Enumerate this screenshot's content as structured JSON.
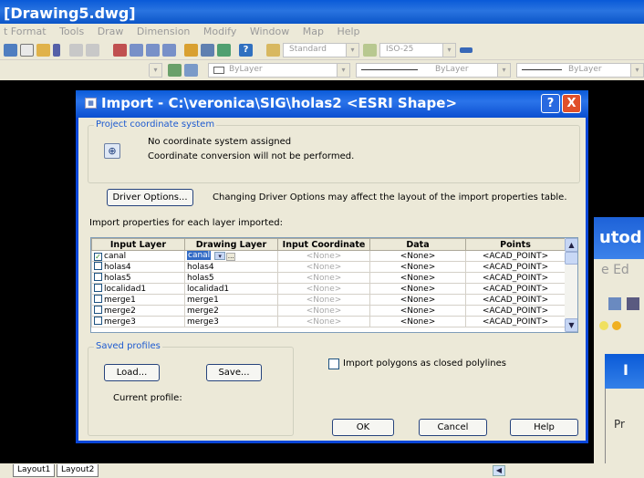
{
  "acad": {
    "title": "[Drawing5.dwg]",
    "menu": [
      "t Format",
      "Tools",
      "Draw",
      "Dimension",
      "Modify",
      "Window",
      "Map",
      "Help"
    ],
    "text_style": "Standard",
    "dim_style": "ISO-25",
    "layer_color": "ByLayer",
    "linetype": "ByLayer",
    "lineweight": "ByLayer",
    "tabs": [
      "Layout1",
      "Layout2"
    ]
  },
  "bg_window2": {
    "title_fragment": "utod",
    "menu_fragment": "e  Ed",
    "dialog_title_fragment": "I",
    "body_fragment": "Pr"
  },
  "dialog": {
    "title": "Import - C:\\veronica\\SIG\\holas2 <ESRI Shape>",
    "help_label": "?",
    "close_label": "X",
    "coord_group_label": "Project coordinate system",
    "coord_line1": "No coordinate system assigned",
    "coord_line2": "Coordinate conversion will not be performed.",
    "driver_button": "Driver Options...",
    "driver_note": "Changing Driver Options may affect the layout of the import properties table.",
    "import_props_label": "Import properties for each layer imported:",
    "columns": [
      "Input Layer",
      "Drawing Layer",
      "Input Coordinate",
      "Data",
      "Points"
    ],
    "rows": [
      {
        "checked": true,
        "input": "canal",
        "drawing": "canal",
        "coord": "<None>",
        "data": "<None>",
        "points": "<ACAD_POINT>"
      },
      {
        "checked": false,
        "input": "holas4",
        "drawing": "holas4",
        "coord": "<None>",
        "data": "<None>",
        "points": "<ACAD_POINT>"
      },
      {
        "checked": false,
        "input": "holas5",
        "drawing": "holas5",
        "coord": "<None>",
        "data": "<None>",
        "points": "<ACAD_POINT>"
      },
      {
        "checked": false,
        "input": "localidad1",
        "drawing": "localidad1",
        "coord": "<None>",
        "data": "<None>",
        "points": "<ACAD_POINT>"
      },
      {
        "checked": false,
        "input": "merge1",
        "drawing": "merge1",
        "coord": "<None>",
        "data": "<None>",
        "points": "<ACAD_POINT>"
      },
      {
        "checked": false,
        "input": "merge2",
        "drawing": "merge2",
        "coord": "<None>",
        "data": "<None>",
        "points": "<ACAD_POINT>"
      },
      {
        "checked": false,
        "input": "merge3",
        "drawing": "merge3",
        "coord": "<None>",
        "data": "<None>",
        "points": "<ACAD_POINT>"
      }
    ],
    "profiles_group_label": "Saved profiles",
    "load_button": "Load...",
    "save_button": "Save...",
    "current_profile_label": "Current profile:",
    "polygons_label": "Import polygons as closed polylines",
    "polygons_checked": false,
    "ok_button": "OK",
    "cancel_button": "Cancel",
    "help_button": "Help"
  },
  "colors": {
    "title_blue": "#0a5ad8",
    "group_label": "#1d5ad0",
    "close_red": "#e0502a",
    "dialog_bg": "#ece9d8"
  }
}
